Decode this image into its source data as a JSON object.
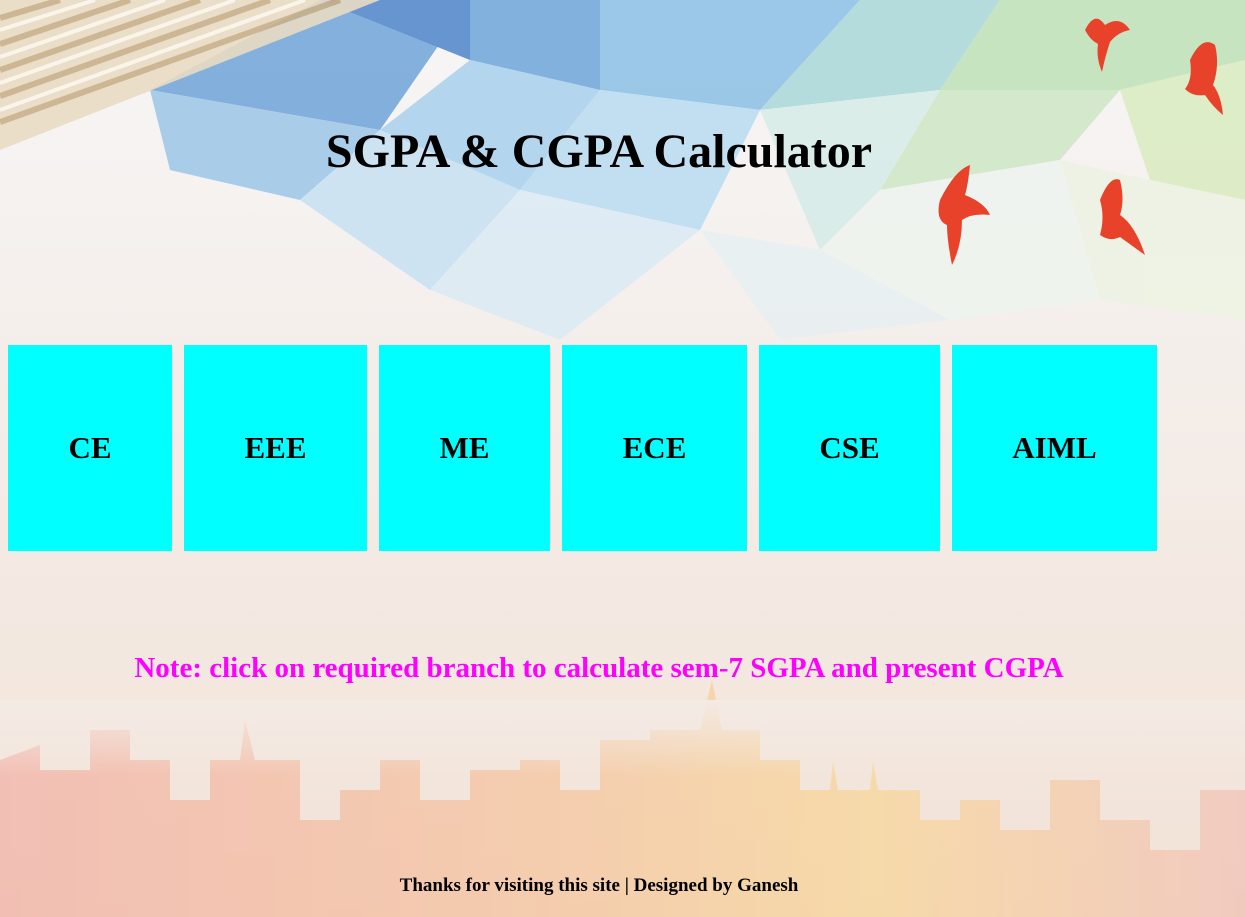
{
  "header": {
    "title": "SGPA & CGPA Calculator"
  },
  "branches": [
    {
      "label": "CE"
    },
    {
      "label": "EEE"
    },
    {
      "label": "ME"
    },
    {
      "label": "ECE"
    },
    {
      "label": "CSE"
    },
    {
      "label": "AIML"
    }
  ],
  "note": {
    "text": "Note: click on required branch to calculate sem-7 SGPA and present CGPA"
  },
  "footer": {
    "text": "Thanks for visiting this site | Designed by Ganesh"
  },
  "colors": {
    "branch_button_bg": "#00ffff",
    "note_text": "#ff00ff",
    "title_text": "#000000"
  },
  "icons": [
    "rope-decoration",
    "bird-icon",
    "city-skyline-decoration"
  ]
}
